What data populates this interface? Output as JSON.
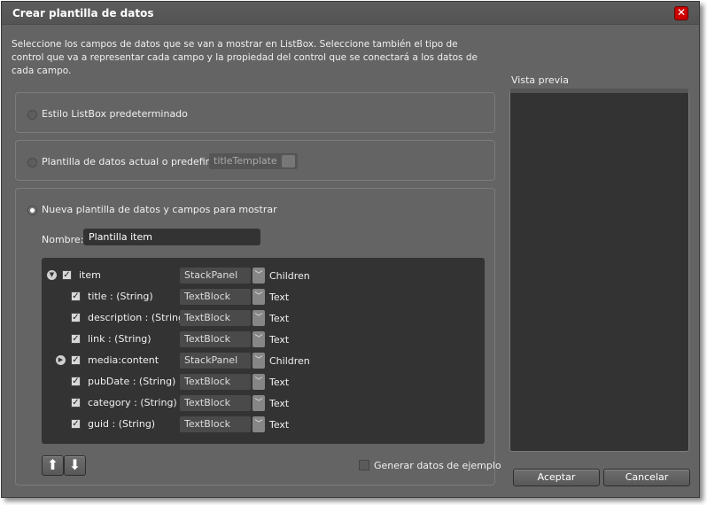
{
  "dialog": {
    "title": "Crear plantilla de datos",
    "close_icon": "close-icon",
    "description": "Seleccione los campos de datos que se van a mostrar en ListBox. Seleccione también el tipo de control que va a representar cada campo y la propiedad del control que se conectará a los datos de cada campo."
  },
  "options": {
    "default_style": {
      "label": "Estilo ListBox predeterminado",
      "selected": false
    },
    "existing_template": {
      "label": "Plantilla de datos actual o predefinida:",
      "value": "titleTemplate",
      "selected": false
    },
    "new_template": {
      "label": "Nueva plantilla de datos y campos para mostrar",
      "selected": true
    }
  },
  "name_field": {
    "label": "Nombre:",
    "value": "Plantilla item"
  },
  "fields": [
    {
      "name": "item",
      "control": "StackPanel",
      "property": "Children",
      "checked": true,
      "level": 0,
      "expander": "expanded"
    },
    {
      "name": "title : (String)",
      "control": "TextBlock",
      "property": "Text",
      "checked": true,
      "level": 1
    },
    {
      "name": "description : (String)",
      "control": "TextBlock",
      "property": "Text",
      "checked": true,
      "level": 1
    },
    {
      "name": "link : (String)",
      "control": "TextBlock",
      "property": "Text",
      "checked": true,
      "level": 1
    },
    {
      "name": "media:content",
      "control": "StackPanel",
      "property": "Children",
      "checked": true,
      "level": 1,
      "expander": "collapsed"
    },
    {
      "name": "pubDate : (String)",
      "control": "TextBlock",
      "property": "Text",
      "checked": true,
      "level": 1
    },
    {
      "name": "category : (String)",
      "control": "TextBlock",
      "property": "Text",
      "checked": true,
      "level": 1
    },
    {
      "name": "guid : (String)",
      "control": "TextBlock",
      "property": "Text",
      "checked": true,
      "level": 1
    }
  ],
  "sample_data": {
    "label": "Generar datos de ejemplo",
    "checked": false
  },
  "preview": {
    "label": "Vista previa"
  },
  "buttons": {
    "ok": "Aceptar",
    "cancel": "Cancelar"
  },
  "icons": {
    "move_up": "arrow-up-icon",
    "move_down": "arrow-down-icon"
  }
}
